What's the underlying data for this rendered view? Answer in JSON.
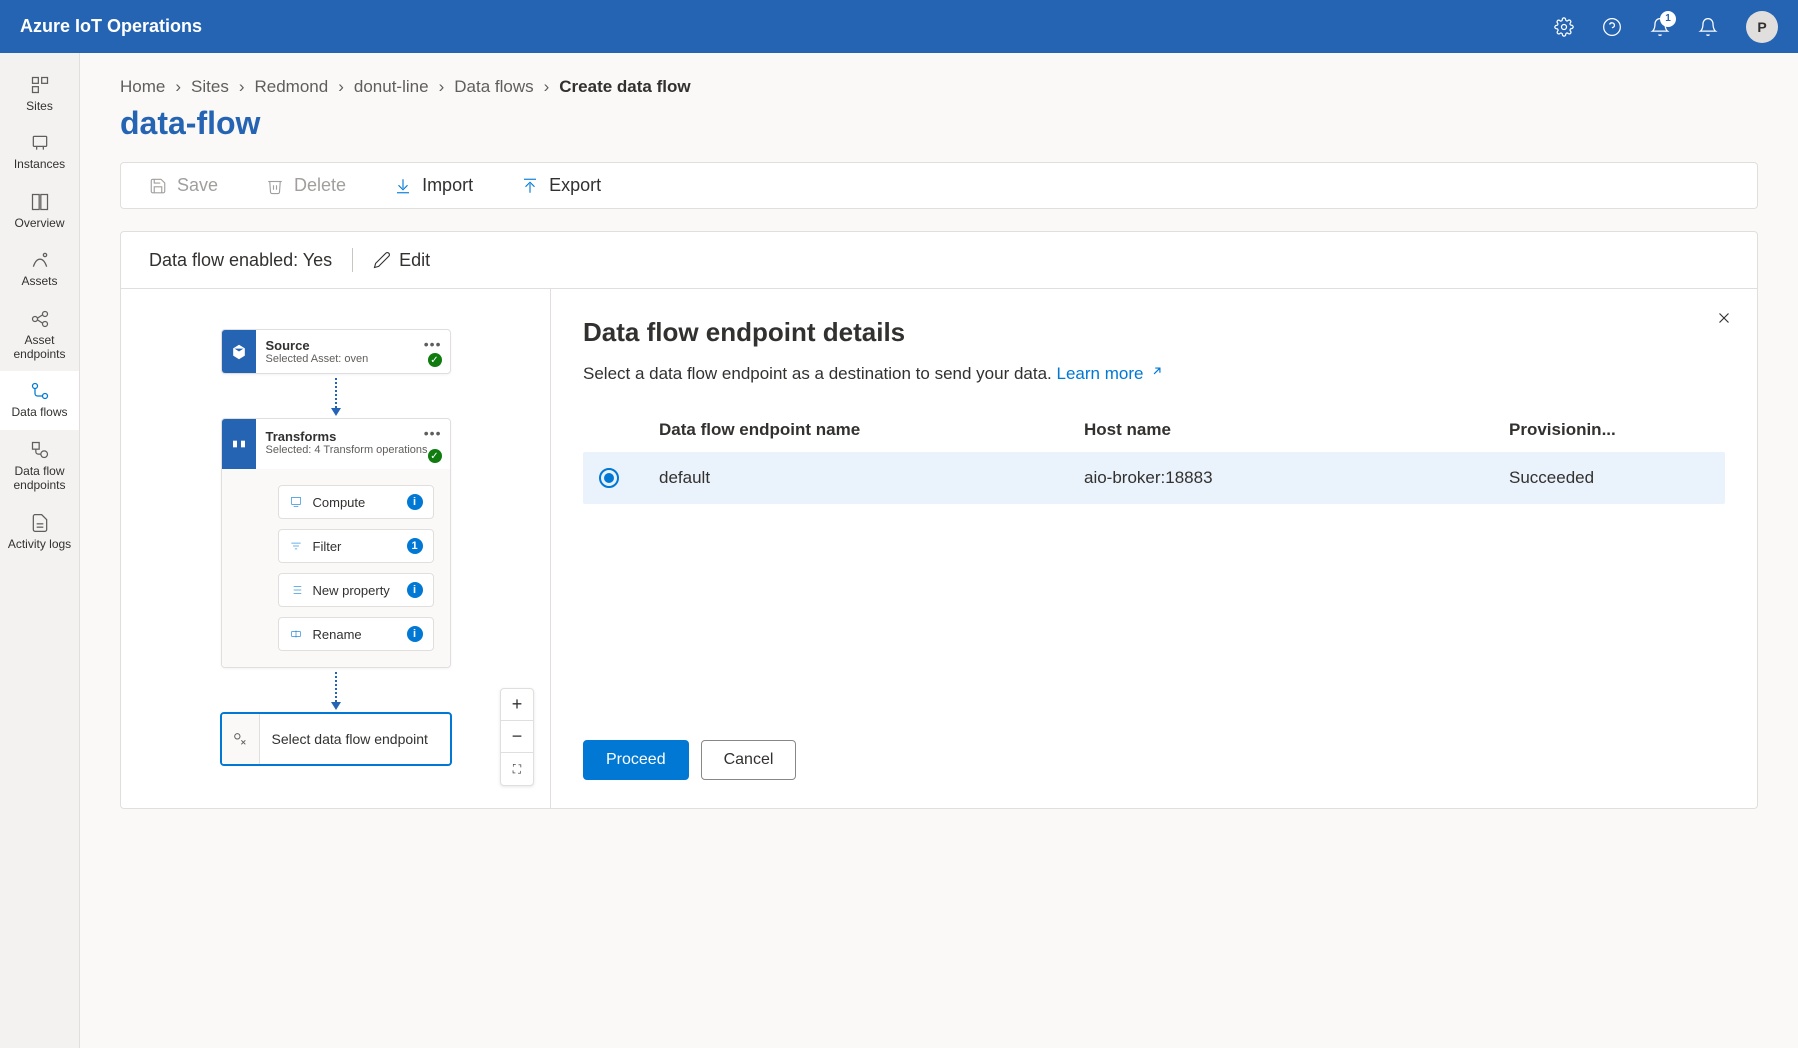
{
  "header": {
    "title": "Azure IoT Operations",
    "notification_count": "1",
    "avatar_initial": "P"
  },
  "sidebar": {
    "items": [
      {
        "label": "Sites"
      },
      {
        "label": "Instances"
      },
      {
        "label": "Overview"
      },
      {
        "label": "Assets"
      },
      {
        "label": "Asset endpoints"
      },
      {
        "label": "Data flows"
      },
      {
        "label": "Data flow endpoints"
      },
      {
        "label": "Activity logs"
      }
    ]
  },
  "breadcrumb": {
    "items": [
      "Home",
      "Sites",
      "Redmond",
      "donut-line",
      "Data flows"
    ],
    "current": "Create data flow"
  },
  "page": {
    "title": "data-flow"
  },
  "toolbar": {
    "save": "Save",
    "delete": "Delete",
    "import": "Import",
    "export": "Export"
  },
  "editor": {
    "enabled_label": "Data flow enabled: Yes",
    "edit": "Edit",
    "source": {
      "title": "Source",
      "sub": "Selected Asset: oven"
    },
    "transforms": {
      "title": "Transforms",
      "sub": "Selected: 4 Transform operations",
      "items": [
        {
          "label": "Compute",
          "badge": "i"
        },
        {
          "label": "Filter",
          "badge": "1"
        },
        {
          "label": "New property",
          "badge": "i"
        },
        {
          "label": "Rename",
          "badge": "i"
        }
      ]
    },
    "destination": {
      "label": "Select data flow endpoint"
    }
  },
  "details": {
    "title": "Data flow endpoint details",
    "desc": "Select a data flow endpoint as a destination to send your data. ",
    "learn_more": "Learn more",
    "columns": {
      "name": "Data flow endpoint name",
      "host": "Host name",
      "prov": "Provisionin..."
    },
    "rows": [
      {
        "name": "default",
        "host": "aio-broker:18883",
        "prov": "Succeeded"
      }
    ],
    "proceed": "Proceed",
    "cancel": "Cancel"
  }
}
